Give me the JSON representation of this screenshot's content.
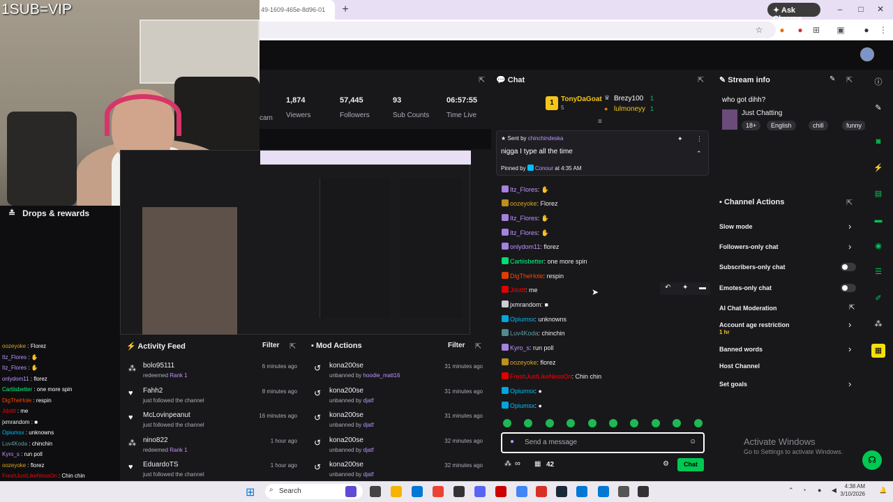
{
  "webcam": {
    "overlay_text": "1SUB=VIP"
  },
  "browser": {
    "tab_title": "49-1609-465e-8d96-01",
    "new_tab": "+",
    "ask_chrome": "Ask Chrome",
    "window_buttons": {
      "minimize": "–",
      "maximize": "□",
      "close": "✕"
    }
  },
  "left": {
    "drops_label": "Drops & rewards",
    "chat": [
      {
        "user": "oozeyoke",
        "msg": " : Florez",
        "color": "#daa520"
      },
      {
        "user": "Itz_Flores",
        "msg": " : ✋",
        "color": "#bf94ff"
      },
      {
        "user": "Itz_Flores",
        "msg": " : ✋",
        "color": "#bf94ff"
      },
      {
        "user": "onlydom11",
        "msg": " : florez",
        "color": "#bf94ff"
      },
      {
        "user": "Cartiisbetter",
        "msg": " : one more spin",
        "color": "#00ff7f"
      },
      {
        "user": "DigTheHole",
        "msg": " : respin",
        "color": "#ff4500"
      },
      {
        "user": "Jdottt",
        "msg": " : me",
        "color": "#ff0000"
      },
      {
        "user": "jxmrandom",
        "msg": " : ■",
        "color": "#efeff1"
      },
      {
        "user": "Opiumsx",
        "msg": " : unknowns",
        "color": "#00bfff"
      },
      {
        "user": "Luv4Koda",
        "msg": " : chinchin",
        "color": "#5f9ea0"
      },
      {
        "user": "Kyro_s",
        "msg": " : run poll",
        "color": "#bf94ff"
      },
      {
        "user": "oozeyoke",
        "msg": " : florez",
        "color": "#daa520"
      },
      {
        "user": "FreshJustLikeNessOn",
        "msg": " : Chin chin",
        "color": "#ff0000"
      }
    ]
  },
  "stats": [
    {
      "value": "1,874",
      "label": "Viewers"
    },
    {
      "value": "57,445",
      "label": "Followers"
    },
    {
      "value": "93",
      "label": "Sub Counts"
    },
    {
      "value": "06:57:55",
      "label": "Time Live"
    }
  ],
  "stats_partial_label": "cam",
  "activity_feed": {
    "title": "Activity Feed",
    "filter": "Filter",
    "items": [
      {
        "name": "bolo95111",
        "sub_prefix": "redeemed ",
        "sub_hl": "Rank 1",
        "time": "6 minutes ago",
        "icon": "redeem"
      },
      {
        "name": "Fahh2",
        "sub_prefix": "just followed the channel",
        "sub_hl": "",
        "time": "8 minutes ago",
        "icon": "heart"
      },
      {
        "name": "McLovinpeanut",
        "sub_prefix": "just followed the channel",
        "sub_hl": "",
        "time": "16 minutes ago",
        "icon": "heart"
      },
      {
        "name": "nino822",
        "sub_prefix": "redeemed ",
        "sub_hl": "Rank 1",
        "time": "1 hour ago",
        "icon": "redeem"
      },
      {
        "name": "EduardoTS",
        "sub_prefix": "just followed the channel",
        "sub_hl": "",
        "time": "1 hour ago",
        "icon": "heart"
      }
    ]
  },
  "mod_actions": {
    "title": "Mod Actions",
    "filter": "Filter",
    "items": [
      {
        "name": "kona200se",
        "sub_prefix": "unbanned by ",
        "sub_hl": "hoodie_matt16",
        "time": "31 minutes ago"
      },
      {
        "name": "kona200se",
        "sub_prefix": "unbanned by ",
        "sub_hl": "djatf",
        "time": "31 minutes ago"
      },
      {
        "name": "kona200se",
        "sub_prefix": "unbanned by ",
        "sub_hl": "djatf",
        "time": "31 minutes ago"
      },
      {
        "name": "kona200se",
        "sub_prefix": "unbanned by ",
        "sub_hl": "djatf",
        "time": "32 minutes ago"
      },
      {
        "name": "kona200se",
        "sub_prefix": "unbanned by ",
        "sub_hl": "djatf",
        "time": "32 minutes ago"
      }
    ]
  },
  "chat": {
    "title": "Chat",
    "leaderboard": {
      "first": "TonyDaGoat",
      "first_count": "5",
      "first_rank": "1",
      "second": "Brezy100",
      "second_count": "1",
      "third": "lulmoneyy",
      "third_count": "1"
    },
    "pinned": {
      "sent_by_prefix": "Sent by ",
      "sent_by": "chinchindeska",
      "message": "nigga I type all the time",
      "pinned_by_prefix": "Pinned by ",
      "pinned_by": "Conour",
      "pinned_at": " at 4:35 AM"
    },
    "messages": [
      {
        "user": "Itz_Flores",
        "text": ": ✋",
        "color": "#bf94ff"
      },
      {
        "user": "oozeyoke",
        "text": ": Florez",
        "color": "#daa520"
      },
      {
        "user": "Itz_Flores",
        "text": ": ✋",
        "color": "#bf94ff"
      },
      {
        "user": "Itz_Flores",
        "text": ": ✋",
        "color": "#bf94ff"
      },
      {
        "user": "onlydom11",
        "text": ": florez",
        "color": "#bf94ff"
      },
      {
        "user": "Cartiisbetter",
        "text": ": one more spin",
        "color": "#00ff7f"
      },
      {
        "user": "DigTheHole",
        "text": ": respin",
        "color": "#ff4500"
      },
      {
        "user": "Jdottt",
        "text": ": me",
        "color": "#ff0000"
      },
      {
        "user": "jxmrandom",
        "text": ": ■",
        "color": "#efeff1"
      },
      {
        "user": "Opiumsx",
        "text": ": unknowns",
        "color": "#00bfff"
      },
      {
        "user": "Luv4Koda",
        "text": ": chinchin",
        "color": "#5f9ea0"
      },
      {
        "user": "Kyro_s",
        "text": ": run poll",
        "color": "#bf94ff"
      },
      {
        "user": "oozeyoke",
        "text": ": florez",
        "color": "#daa520"
      },
      {
        "user": "FreshJustLikeNessOn",
        "text": ": Chin chin",
        "color": "#ff0000"
      },
      {
        "user": "Opiumsx",
        "text": ": ●",
        "color": "#00bfff"
      },
      {
        "user": "Opiumsx",
        "text": ": ●",
        "color": "#00bfff"
      }
    ],
    "input_placeholder": "Send a message",
    "points": "42",
    "chat_button": "Chat"
  },
  "stream_info": {
    "title": "Stream info",
    "stream_title": "who got dihh?",
    "category": "Just Chatting",
    "tags": [
      "18+",
      "English",
      "chill",
      "funny"
    ]
  },
  "channel_actions": {
    "title": "Channel Actions",
    "items": [
      {
        "label": "Slow mode",
        "control": "chevron"
      },
      {
        "label": "Followers-only chat",
        "control": "chevron"
      },
      {
        "label": "Subscribers-only chat",
        "control": "toggle"
      },
      {
        "label": "Emotes-only chat",
        "control": "toggle"
      },
      {
        "label": "AI Chat Moderation",
        "control": "external"
      },
      {
        "label": "Account age restriction",
        "sub": "1 hr",
        "control": "chevron"
      },
      {
        "label": "Banned words",
        "control": "chevron"
      },
      {
        "label": "Host Channel",
        "control": "none"
      },
      {
        "label": "Set goals",
        "control": "chevron"
      }
    ]
  },
  "watermark": {
    "line1": "Activate Windows",
    "line2": "Go to Settings to activate Windows."
  },
  "taskbar": {
    "search": "Search",
    "time": "4:38 AM",
    "date": "3/10/2026"
  }
}
